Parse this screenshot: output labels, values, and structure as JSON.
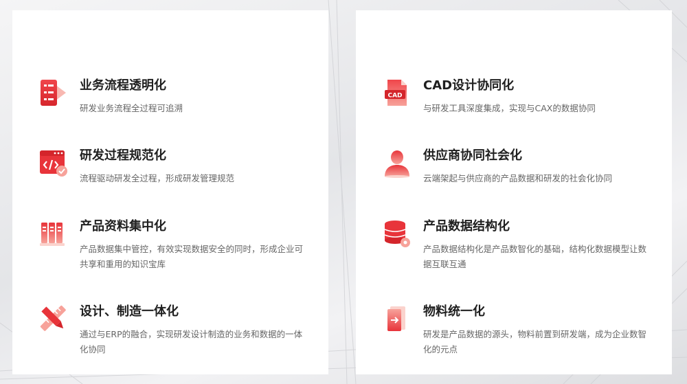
{
  "theme": {
    "accent": "#e8343a",
    "accent_light": "#f7a29a",
    "title_color": "#1f1f1f",
    "desc_color": "#666666"
  },
  "left_panel": {
    "features": [
      {
        "icon": "process-flow-icon",
        "title": "业务流程透明化",
        "desc": "研发业务流程全过程可追溯"
      },
      {
        "icon": "code-window-icon",
        "title": "研发过程规范化",
        "desc": "流程驱动研发全过程，形成研发管理规范"
      },
      {
        "icon": "document-stack-icon",
        "title": "产品资料集中化",
        "desc": "产品数据集中管控，有效实现数据安全的同时，形成企业可共享和重用的知识宝库"
      },
      {
        "icon": "ruler-pencil-icon",
        "title": "设计、制造一体化",
        "desc": "通过与ERP的融合，实现研发设计制造的业务和数据的一体化协同"
      }
    ]
  },
  "right_panel": {
    "features": [
      {
        "icon": "cad-file-icon",
        "icon_text": "CAD",
        "title": "CAD设计协同化",
        "desc": "与研发工具深度集成，实现与CAX的数据协同"
      },
      {
        "icon": "supplier-user-icon",
        "title": "供应商协同社会化",
        "desc": "云端架起与供应商的产品数据和研发的社会化协同"
      },
      {
        "icon": "database-icon",
        "title": "产品数据结构化",
        "desc": "产品数据结构化是产品数智化的基础，结构化数据模型让数据互联互通"
      },
      {
        "icon": "material-door-icon",
        "title": "物料统一化",
        "desc": "研发是产品数据的源头，物料前置到研发端，成为企业数智化的元点"
      }
    ]
  }
}
